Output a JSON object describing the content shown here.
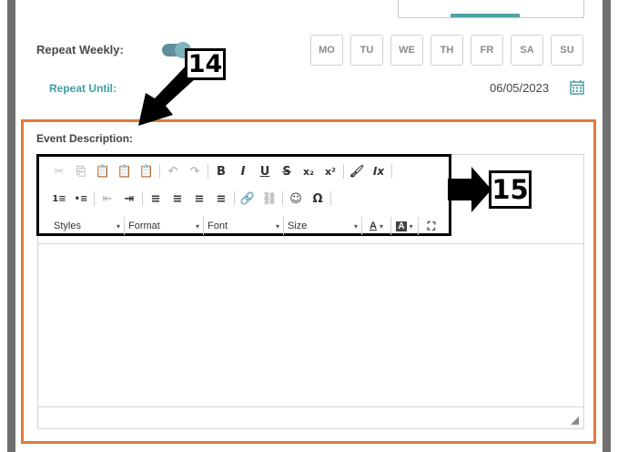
{
  "repeat": {
    "label": "Repeat Weekly:",
    "enabled": true,
    "days": [
      "MO",
      "TU",
      "WE",
      "TH",
      "FR",
      "SA",
      "SU"
    ]
  },
  "until": {
    "label": "Repeat Until:",
    "value": "06/05/2023"
  },
  "event_description": {
    "label": "Event Description:"
  },
  "toolbar": {
    "row1": [
      "✂",
      "⎘",
      "📋",
      "📋",
      "📋",
      "↶",
      "↷",
      "B",
      "I",
      "U",
      "S",
      "x₂",
      "x²",
      "🖌",
      "Ix"
    ],
    "row2": [
      "1≡",
      "•≡",
      "⇤",
      "⇥",
      "≡",
      "≡",
      "≡",
      "≡",
      "🔗",
      "⛓",
      "☺",
      "Ω"
    ],
    "dropdowns": {
      "styles": "Styles",
      "format": "Format",
      "font": "Font",
      "size": "Size"
    },
    "text_color_label": "A",
    "bg_color_label": "A"
  },
  "callouts": {
    "c14": "14",
    "c15": "15"
  },
  "colors": {
    "accent_teal": "#4fa3a5",
    "highlight_orange": "#e07a3a"
  }
}
